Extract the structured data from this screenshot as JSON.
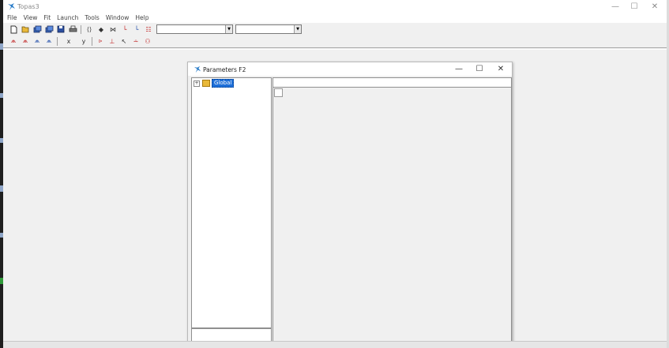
{
  "app": {
    "title": "Topas3",
    "window_controls": {
      "minimize": "—",
      "maximize": "☐",
      "close": "✕"
    },
    "menu": [
      "File",
      "View",
      "Fit",
      "Launch",
      "Tools",
      "Window",
      "Help"
    ],
    "toolbar1": {
      "icons": [
        "new-file-icon",
        "open-folder-icon",
        "open-multiple-icon",
        "open-multiple-icon-2",
        "save-icon",
        "print-icon"
      ],
      "icons2": [
        "pan-left-right-icon",
        "move-diamond-icon",
        "fit-width-icon",
        "plot-peak-icon",
        "plot-axis-icon",
        "plot-grid-icon"
      ],
      "combo1_value": "",
      "combo2_value": ""
    },
    "toolbar2": {
      "icons": [
        "peak-red-icon",
        "peak-double-icon",
        "peak-blue-icon",
        "peak-blue-2-icon"
      ],
      "text_buttons": [
        "x",
        "y"
      ],
      "icons2": [
        "chart-add-icon",
        "tick-marker-icon",
        "cursor-tool-icon",
        "axis-scale-icon",
        "binoculars-icon"
      ]
    }
  },
  "child_window": {
    "title": "Parameters F2",
    "controls": {
      "minimize": "—",
      "maximize": "☐",
      "close": "✕"
    },
    "tree": {
      "expander": "+",
      "root_label": "Global"
    }
  },
  "colors": {
    "accent": "#1e6fd8",
    "folder": "#e9b93a",
    "red": "#c02020",
    "blue": "#1b49a8"
  }
}
